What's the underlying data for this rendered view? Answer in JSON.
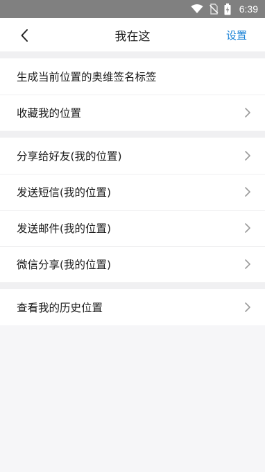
{
  "status_bar": {
    "time": "6:39",
    "icons": [
      "wifi-icon",
      "no-sim-icon",
      "battery-charging-icon"
    ]
  },
  "header": {
    "title": "我在这",
    "settings_label": "设置",
    "back_icon": "back-arrow-icon"
  },
  "groups": [
    {
      "items": [
        {
          "label": "生成当前位置的奥维签名标签",
          "chevron": false
        },
        {
          "label": "收藏我的位置",
          "chevron": true
        }
      ]
    },
    {
      "items": [
        {
          "label": "分享给好友(我的位置)",
          "chevron": true
        },
        {
          "label": "发送短信(我的位置)",
          "chevron": true
        },
        {
          "label": "发送邮件(我的位置)",
          "chevron": true
        },
        {
          "label": "微信分享(我的位置)",
          "chevron": true
        }
      ]
    },
    {
      "items": [
        {
          "label": "查看我的历史位置",
          "chevron": true
        }
      ]
    }
  ],
  "colors": {
    "accent": "#1a82d6",
    "status_bar_bg": "#808080",
    "page_bg": "#f6f6f8"
  }
}
